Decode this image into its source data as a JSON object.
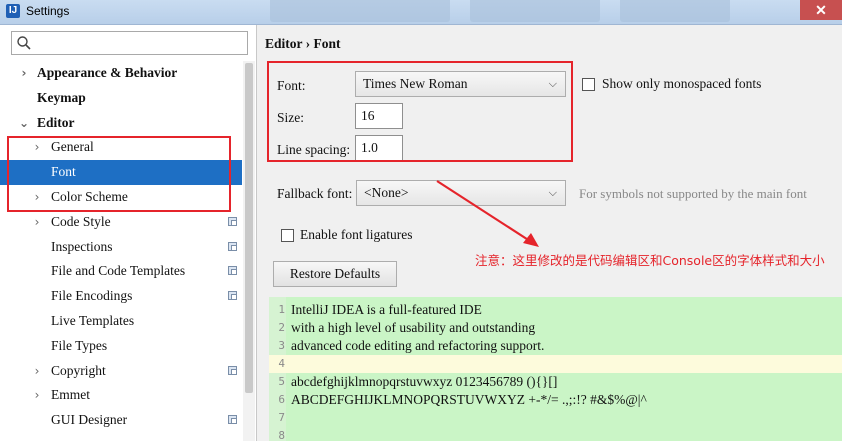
{
  "window": {
    "title": "Settings",
    "app_icon_letter": "IJ",
    "close_glyph": "✕"
  },
  "sidebar": {
    "search_placeholder": "",
    "items": [
      {
        "label": "Appearance & Behavior",
        "bold": true,
        "arrow": "›",
        "indent": 0
      },
      {
        "label": "Keymap",
        "bold": true,
        "arrow": "",
        "indent": 0
      },
      {
        "label": "Editor",
        "bold": true,
        "arrow": "⌄",
        "indent": 0
      },
      {
        "label": "General",
        "bold": false,
        "arrow": "›",
        "indent": 1
      },
      {
        "label": "Font",
        "bold": false,
        "arrow": "",
        "indent": 2,
        "selected": true
      },
      {
        "label": "Color Scheme",
        "bold": false,
        "arrow": "›",
        "indent": 1
      },
      {
        "label": "Code Style",
        "bold": false,
        "arrow": "›",
        "indent": 1,
        "project_icon": true
      },
      {
        "label": "Inspections",
        "bold": false,
        "arrow": "",
        "indent": 2,
        "project_icon": true
      },
      {
        "label": "File and Code Templates",
        "bold": false,
        "arrow": "",
        "indent": 2,
        "project_icon": true
      },
      {
        "label": "File Encodings",
        "bold": false,
        "arrow": "",
        "indent": 2,
        "project_icon": true
      },
      {
        "label": "Live Templates",
        "bold": false,
        "arrow": "",
        "indent": 2
      },
      {
        "label": "File Types",
        "bold": false,
        "arrow": "",
        "indent": 2
      },
      {
        "label": "Copyright",
        "bold": false,
        "arrow": "›",
        "indent": 1,
        "project_icon": true
      },
      {
        "label": "Emmet",
        "bold": false,
        "arrow": "›",
        "indent": 1
      },
      {
        "label": "GUI Designer",
        "bold": false,
        "arrow": "",
        "indent": 2,
        "project_icon": true
      }
    ]
  },
  "main": {
    "breadcrumb": "Editor › Font",
    "font_label": "Font:",
    "font_value": "Times New Roman",
    "show_mono_label": "Show only monospaced fonts",
    "size_label": "Size:",
    "size_value": "16",
    "line_spacing_label": "Line spacing:",
    "line_spacing_value": "1.0",
    "fallback_label": "Fallback font:",
    "fallback_value": "<None>",
    "fallback_hint": "For symbols not supported by the main font",
    "ligatures_label": "Enable font ligatures",
    "restore_label": "Restore Defaults",
    "annotation": "注意：这里修改的是代码编辑区和Console区的字体样式和大小",
    "preview_lines": [
      {
        "num": "1",
        "text": "IntelliJ IDEA is a full-featured IDE"
      },
      {
        "num": "2",
        "text": "with a high level of usability and outstanding"
      },
      {
        "num": "3",
        "text": "advanced code editing and refactoring support."
      },
      {
        "num": "4",
        "text": "",
        "current": true
      },
      {
        "num": "5",
        "text": "abcdefghijklmnopqrstuvwxyz 0123456789 (){}[]"
      },
      {
        "num": "6",
        "text": "ABCDEFGHIJKLMNOPQRSTUVWXYZ +-*/= .,;:!? #&$%@|^"
      },
      {
        "num": "7",
        "text": ""
      },
      {
        "num": "8",
        "text": ""
      }
    ]
  },
  "colors": {
    "selection": "#1e6fc4",
    "highlight_box": "#e5242b",
    "preview_bg": "#caf5c6",
    "current_line": "#fdfbdc"
  }
}
